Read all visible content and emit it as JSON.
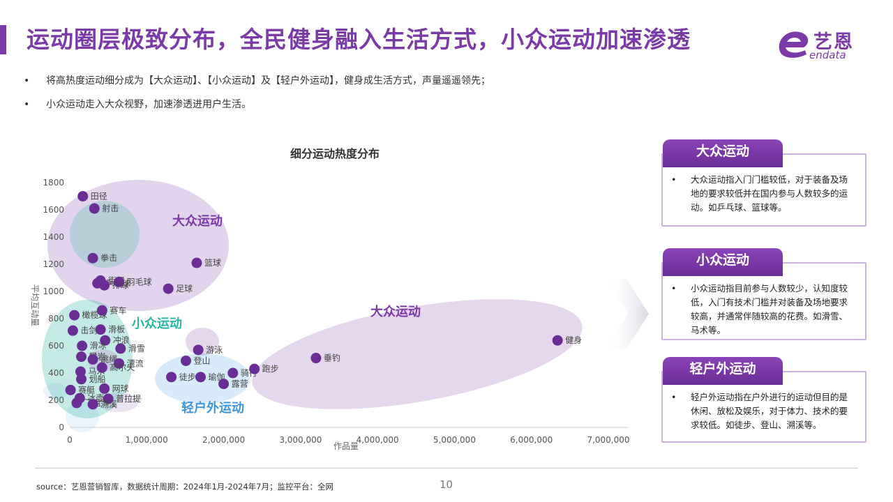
{
  "page": {
    "title": "运动圈层极致分布，全民健身融入生活方式，小众运动加速渗透",
    "logo_text": "艺恩",
    "logo_sub": "endata",
    "bullets": [
      "将高热度运动细分成为【大众运动】、【小众运动】及【轻户外运动】，健身成生活方式，声量遥遥领先；",
      "小众运动走入大众视野，加速渗透进用户生活。"
    ],
    "source": "source：艺恩营销智库，数据统计周期：2024年1月-2024年7月；监控平台：全网",
    "page_number": "10",
    "brand_color": "#7b3aa8"
  },
  "cards": [
    {
      "title": "大众运动",
      "lines": [
        "大众运动指入门门槛较低，对于装备及场",
        "地的要求较低并在国内参与人数较多的运",
        "动。如乒乓球、篮球等。"
      ]
    },
    {
      "title": "小众运动",
      "lines": [
        "小众运动指目前参与人数较少，认知度较",
        "低，入门有技术门槛并对装备及场地要求",
        "较高，并通常伴随较高的花费。如滑雪、",
        "马术等。"
      ]
    },
    {
      "title": "轻户外运动",
      "lines": [
        "轻户外运动指在户外进行的运动但目的是",
        "休闲、放松及娱乐，对于体力、技术的要",
        "求较低。如徒步、登山、溯溪等。"
      ]
    }
  ],
  "chart_data": {
    "type": "scatter",
    "title": "细分运动热度分布",
    "xlabel": "作品量",
    "ylabel": "平均互动量",
    "xlim": [
      0,
      7000000
    ],
    "ylim": [
      0,
      1800
    ],
    "xticks": [
      0,
      1000000,
      2000000,
      3000000,
      4000000,
      5000000,
      6000000,
      7000000
    ],
    "xtick_labels": [
      "0",
      "1,000,000",
      "2,000,000",
      "3,000,000",
      "4,000,000",
      "5,000,000",
      "6,000,000",
      "7,000,000"
    ],
    "yticks": [
      0,
      200,
      400,
      600,
      800,
      1000,
      1200,
      1400,
      1600,
      1800
    ],
    "point_color": "#6a2d96",
    "points": [
      {
        "label": "田径",
        "x": 170000,
        "y": 1700
      },
      {
        "label": "射击",
        "x": 320000,
        "y": 1610
      },
      {
        "label": "拳击",
        "x": 300000,
        "y": 1245
      },
      {
        "label": "篮球",
        "x": 1650000,
        "y": 1210
      },
      {
        "label": "街舞",
        "x": 400000,
        "y": 1080
      },
      {
        "label": "乒乓球",
        "x": 360000,
        "y": 1060
      },
      {
        "label": "羽毛球",
        "x": 640000,
        "y": 1070
      },
      {
        "label": "排球",
        "x": 450000,
        "y": 1045
      },
      {
        "label": "足球",
        "x": 1280000,
        "y": 1020
      },
      {
        "label": "橄榄球",
        "x": 60000,
        "y": 825
      },
      {
        "label": "赛车",
        "x": 420000,
        "y": 860
      },
      {
        "label": "击剑",
        "x": 40000,
        "y": 712
      },
      {
        "label": "滑板",
        "x": 400000,
        "y": 720
      },
      {
        "label": "冲浪",
        "x": 460000,
        "y": 640
      },
      {
        "label": "滑冰",
        "x": 160000,
        "y": 600
      },
      {
        "label": "滑雪",
        "x": 660000,
        "y": 580
      },
      {
        "label": "攀岩",
        "x": 150000,
        "y": 520
      },
      {
        "label": "跳绳",
        "x": 300000,
        "y": 500
      },
      {
        "label": "漂流",
        "x": 640000,
        "y": 470
      },
      {
        "label": "马术",
        "x": 140000,
        "y": 410
      },
      {
        "label": "划船",
        "x": 150000,
        "y": 355
      },
      {
        "label": "高尔夫",
        "x": 420000,
        "y": 440
      },
      {
        "label": "赛艇",
        "x": 10000,
        "y": 275
      },
      {
        "label": "网球",
        "x": 450000,
        "y": 285
      },
      {
        "label": "冰壶",
        "x": 130000,
        "y": 215
      },
      {
        "label": "普拉提",
        "x": 500000,
        "y": 210
      },
      {
        "label": "游泳",
        "x": 1670000,
        "y": 570
      },
      {
        "label": "登山",
        "x": 1510000,
        "y": 490
      },
      {
        "label": "骑行",
        "x": 2120000,
        "y": 400
      },
      {
        "label": "跑步",
        "x": 2400000,
        "y": 430
      },
      {
        "label": "徒步",
        "x": 1320000,
        "y": 370
      },
      {
        "label": "瑜伽",
        "x": 1700000,
        "y": 370
      },
      {
        "label": "露营",
        "x": 2000000,
        "y": 320
      },
      {
        "label": "垂钓",
        "x": 3200000,
        "y": 510
      },
      {
        "label": "健身",
        "x": 6340000,
        "y": 640
      },
      {
        "label": "飞盘",
        "x": 90000,
        "y": 180
      },
      {
        "label": "溯溪",
        "x": 300000,
        "y": 170
      }
    ],
    "groups": [
      {
        "label": "大众运动",
        "color": "#7b3aa8"
      },
      {
        "label": "大众运动",
        "color": "#7b3aa8"
      },
      {
        "label": "小众运动",
        "color": "#2bb5a3"
      },
      {
        "label": "轻户外运动",
        "color": "#3d95e0"
      }
    ]
  }
}
